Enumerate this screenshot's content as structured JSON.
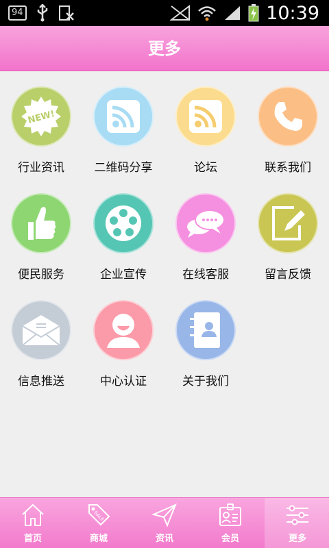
{
  "status_bar": {
    "badge": "94",
    "time": "10:39"
  },
  "header": {
    "title": "更多"
  },
  "grid": {
    "items": [
      {
        "label": "行业资讯",
        "icon": "new-badge-icon",
        "color": "#b9cf6a"
      },
      {
        "label": "二维码分享",
        "icon": "rss-icon",
        "color": "#a8dcf4"
      },
      {
        "label": "论坛",
        "icon": "rss-icon",
        "color": "#fbdc8e"
      },
      {
        "label": "联系我们",
        "icon": "phone-icon",
        "color": "#fbbf86"
      },
      {
        "label": "便民服务",
        "icon": "thumbs-up-icon",
        "color": "#8ed672"
      },
      {
        "label": "企业宣传",
        "icon": "film-reel-icon",
        "color": "#56c6b4"
      },
      {
        "label": "在线客服",
        "icon": "chat-bubbles-icon",
        "color": "#f58fe0"
      },
      {
        "label": "留言反馈",
        "icon": "edit-note-icon",
        "color": "#c9c653"
      },
      {
        "label": "信息推送",
        "icon": "envelope-icon",
        "color": "#c4ccd6"
      },
      {
        "label": "中心认证",
        "icon": "user-icon",
        "color": "#fb9aa8"
      },
      {
        "label": "关于我们",
        "icon": "contact-book-icon",
        "color": "#98b6e8"
      }
    ]
  },
  "tabbar": {
    "active_index": 4,
    "items": [
      {
        "label": "首页",
        "icon": "home-icon"
      },
      {
        "label": "商城",
        "icon": "sale-tag-icon"
      },
      {
        "label": "资讯",
        "icon": "paper-plane-icon"
      },
      {
        "label": "会员",
        "icon": "member-card-icon"
      },
      {
        "label": "更多",
        "icon": "settings-sliders-icon"
      }
    ]
  }
}
